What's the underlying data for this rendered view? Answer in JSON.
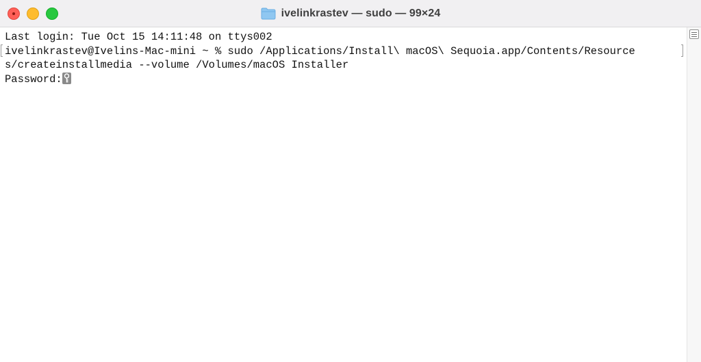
{
  "window": {
    "title": "ivelinkrastev — sudo — 99×24",
    "folder_icon": "folder-icon",
    "controls": {
      "close": "close-button",
      "minimize": "minimize-button",
      "zoom": "zoom-button"
    },
    "colors": {
      "close": "#fe5f57",
      "minimize": "#febc2e",
      "zoom": "#28c840",
      "titlebar": "#f1f0f2",
      "folder": "#8fc7f1"
    }
  },
  "terminal": {
    "lines": [
      "Last login: Tue Oct 15 14:11:48 on ttys002",
      "ivelinkrastev@Ivelins-Mac-mini ~ % sudo /Applications/Install\\ macOS\\ Sequoia.app/Contents/Resource",
      "s/createinstallmedia --volume /Volumes/macOS Installer"
    ],
    "password_prompt": "Password:",
    "cursor_icon": "key-icon"
  },
  "scrollbar": {
    "icon": "scroll-marks-icon"
  }
}
